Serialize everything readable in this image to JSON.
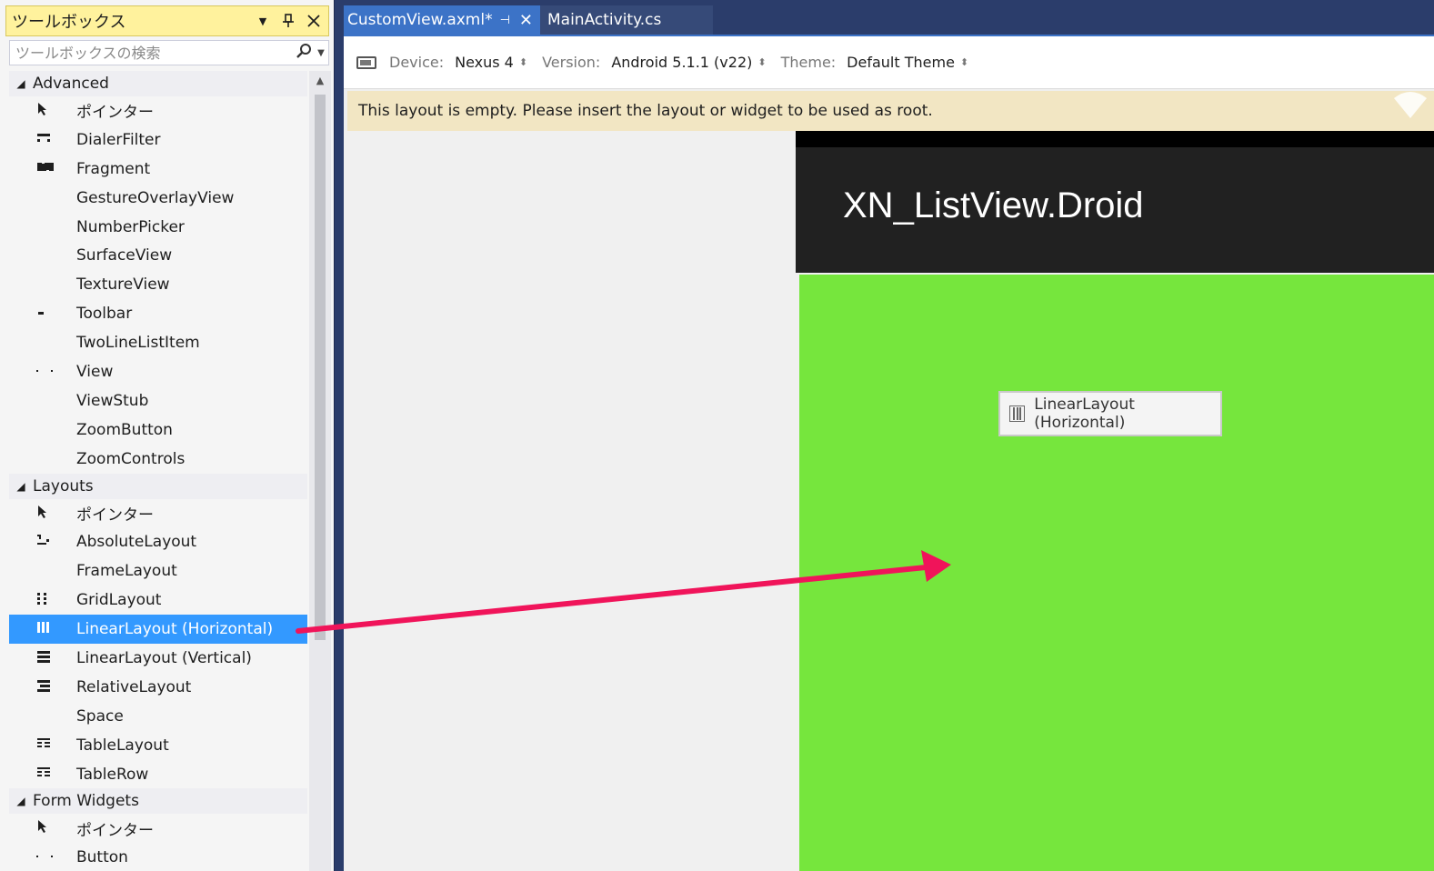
{
  "toolbox": {
    "title": "ツールボックス",
    "title_buttons": [
      "▼",
      "⊥",
      "✕"
    ],
    "search_placeholder": "ツールボックスの検索",
    "groups": [
      {
        "name": "Advanced",
        "items": [
          {
            "label": "ポインター",
            "icon": "pointer-icon"
          },
          {
            "label": "DialerFilter",
            "icon": "dialer-filter-icon"
          },
          {
            "label": "Fragment",
            "icon": "fragment-icon"
          },
          {
            "label": "GestureOverlayView",
            "icon": ""
          },
          {
            "label": "NumberPicker",
            "icon": ""
          },
          {
            "label": "SurfaceView",
            "icon": ""
          },
          {
            "label": "TextureView",
            "icon": ""
          },
          {
            "label": "Toolbar",
            "icon": "toolbar-icon"
          },
          {
            "label": "TwoLineListItem",
            "icon": ""
          },
          {
            "label": "View",
            "icon": "view-icon"
          },
          {
            "label": "ViewStub",
            "icon": ""
          },
          {
            "label": "ZoomButton",
            "icon": ""
          },
          {
            "label": "ZoomControls",
            "icon": ""
          }
        ]
      },
      {
        "name": "Layouts",
        "items": [
          {
            "label": "ポインター",
            "icon": "pointer-icon"
          },
          {
            "label": "AbsoluteLayout",
            "icon": "absolute-layout-icon"
          },
          {
            "label": "FrameLayout",
            "icon": ""
          },
          {
            "label": "GridLayout",
            "icon": "grid-layout-icon"
          },
          {
            "label": "LinearLayout (Horizontal)",
            "icon": "linear-horizontal-icon",
            "selected": true
          },
          {
            "label": "LinearLayout (Vertical)",
            "icon": "linear-vertical-icon"
          },
          {
            "label": "RelativeLayout",
            "icon": "relative-layout-icon"
          },
          {
            "label": "Space",
            "icon": ""
          },
          {
            "label": "TableLayout",
            "icon": "table-layout-icon"
          },
          {
            "label": "TableRow",
            "icon": "table-row-icon"
          }
        ]
      },
      {
        "name": "Form Widgets",
        "items": [
          {
            "label": "ポインター",
            "icon": "pointer-icon"
          },
          {
            "label": "Button",
            "icon": "button-icon"
          }
        ]
      }
    ]
  },
  "tabs": {
    "active": "CustomView.axml*",
    "inactive": "MainActivity.cs"
  },
  "device_bar": {
    "device_label": "Device:",
    "device_value": "Nexus 4",
    "version_label": "Version:",
    "version_value": "Android 5.1.1 (v22)",
    "theme_label": "Theme:",
    "theme_value": "Default Theme"
  },
  "warning": "This layout is empty. Please insert the layout or widget to be used as root.",
  "phone": {
    "app_title": "XN_ListView.Droid",
    "drop_tip": "LinearLayout (Horizontal)"
  },
  "colors": {
    "selection": "#3399ff",
    "green_canvas": "#76e63d",
    "arrow": "#f0145a",
    "tab_active": "#3c73c7"
  }
}
